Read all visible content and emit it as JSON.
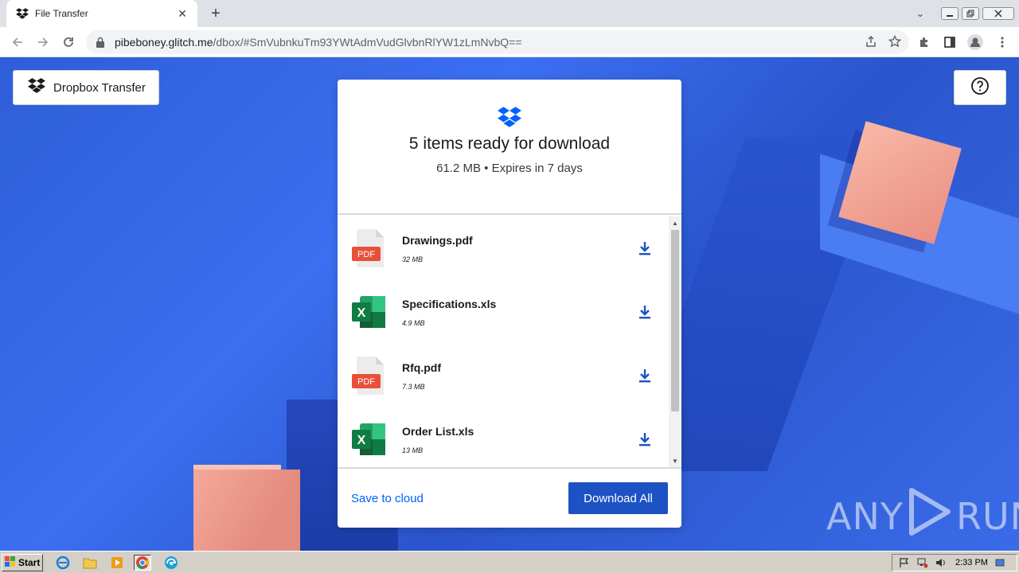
{
  "browser": {
    "tab": {
      "title": "File Transfer",
      "close": "✕"
    },
    "new_tab": "+",
    "window_dropdown": "⌄",
    "url": {
      "host": "pibeboney.glitch.me",
      "path": "/dbox/#SmVubnkuTm93YWtAdmVudGlvbnRlYW1zLmNvbQ=="
    }
  },
  "page": {
    "brand_button": "Dropbox Transfer",
    "help_icon": "question-mark-circle-icon",
    "card": {
      "title": "5 items ready for download",
      "subtitle": "61.2 MB • Expires in 7 days",
      "files": [
        {
          "name": "Drawings.pdf",
          "size": "32 MB",
          "type": "pdf"
        },
        {
          "name": "Specifications.xls",
          "size": "4.9 MB",
          "type": "xls"
        },
        {
          "name": "Rfq.pdf",
          "size": "7.3 MB",
          "type": "pdf"
        },
        {
          "name": "Order List.xls",
          "size": "13 MB",
          "type": "xls"
        }
      ],
      "scroll_up": "▲",
      "scroll_down": "▼",
      "save_to_cloud": "Save to cloud",
      "download_all": "Download All"
    },
    "watermark": {
      "left": "ANY",
      "right": "RUN"
    }
  },
  "taskbar": {
    "start": "Start",
    "clock": "2:33 PM"
  },
  "colors": {
    "accent": "#1d52c4",
    "link": "#0061fe",
    "dropbox_blue": "#0061fe",
    "pdf_red": "#e8503a",
    "excel_green": "#1d6f42"
  }
}
